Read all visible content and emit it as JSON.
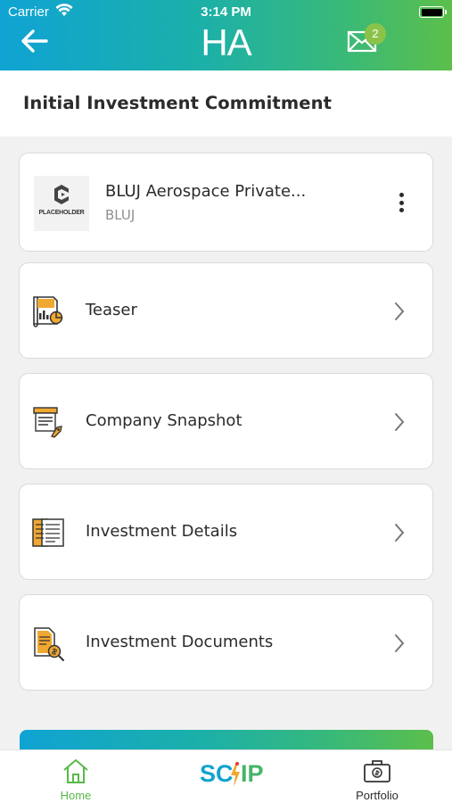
{
  "status_bar": {
    "carrier": "Carrier",
    "time": "3:14 PM"
  },
  "header": {
    "logo": "HA",
    "mail_badge_count": "2"
  },
  "page": {
    "title": "Initial Investment Commitment"
  },
  "company": {
    "name": "BLUJ Aerospace Private...",
    "code": "BLUJ",
    "logo_text": "PLACEHOLDER"
  },
  "menu": [
    {
      "label": "Teaser",
      "icon": "teaser-report-icon"
    },
    {
      "label": "Company Snapshot",
      "icon": "company-snapshot-icon"
    },
    {
      "label": "Investment Details",
      "icon": "investment-details-icon"
    },
    {
      "label": "Investment Documents",
      "icon": "investment-documents-icon"
    }
  ],
  "tabbar": {
    "home_label": "Home",
    "portfolio_label": "Portfolio",
    "center_logo": {
      "part1": "SC",
      "part2": "IP"
    }
  },
  "colors": {
    "brand_blue": "#0fa3d4",
    "brand_green": "#5cbf4a",
    "active_tab": "#59b94a",
    "icon_orange": "#f0a830"
  }
}
